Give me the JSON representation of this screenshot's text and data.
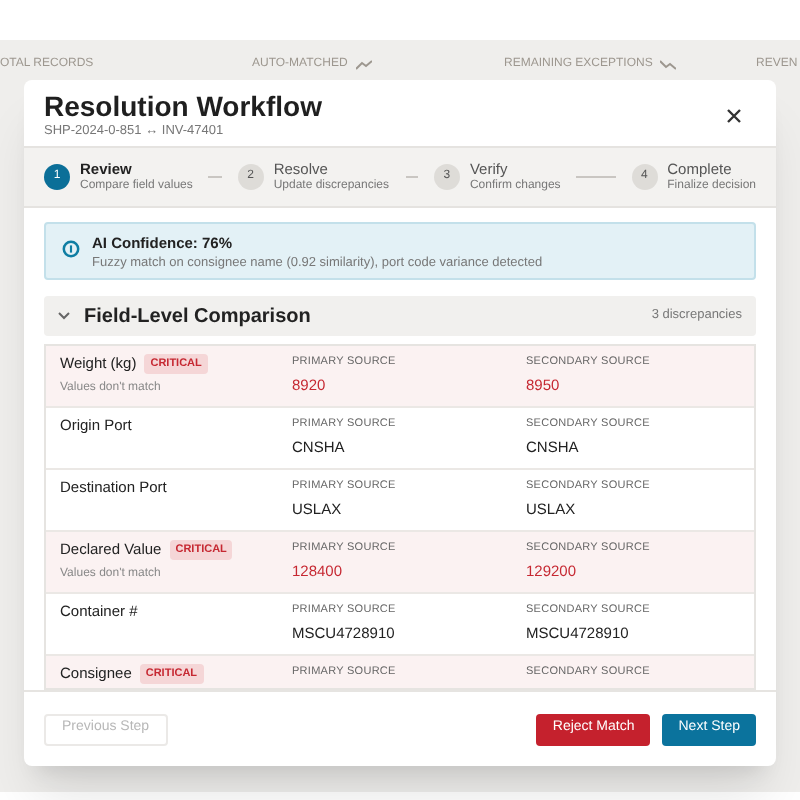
{
  "background_stats": [
    {
      "label": "OTAL RECORDS"
    },
    {
      "label": "AUTO-MATCHED",
      "trend_up": true
    },
    {
      "label": "REMAINING EXCEPTIONS",
      "trend_down": true
    },
    {
      "label": "REVEN"
    }
  ],
  "modal": {
    "title": "Resolution Workflow",
    "subtitle": "SHP-2024-0-851 ↔ INV-47401",
    "steps": [
      {
        "number": "1",
        "title": "Review",
        "subtitle": "Compare field values",
        "selected": true
      },
      {
        "number": "2",
        "title": "Resolve",
        "subtitle": "Update discrepancies",
        "selected": false
      },
      {
        "number": "3",
        "title": "Verify",
        "subtitle": "Confirm changes",
        "selected": false
      },
      {
        "number": "4",
        "title": "Complete",
        "subtitle": "Finalize decision",
        "selected": false
      }
    ],
    "alert": {
      "title": "AI Confidence: 76%",
      "text": "Fuzzy match on consignee name (0.92 similarity), port code variance detected"
    },
    "section": {
      "title": "Field-Level Comparison",
      "expanded": true,
      "count": "3 discrepancies"
    },
    "rows": [
      {
        "field": "Weight (kg)",
        "badge": "CRITICAL",
        "note": "Values don't match",
        "mismatch": true,
        "primary_label": "PRIMARY SOURCE",
        "primary": "8920",
        "secondary_label": "SECONDARY SOURCE",
        "secondary": "8950"
      },
      {
        "field": "Origin Port",
        "mismatch": false,
        "primary_label": "PRIMARY SOURCE",
        "primary": "CNSHA",
        "secondary_label": "SECONDARY SOURCE",
        "secondary": "CNSHA"
      },
      {
        "field": "Destination Port",
        "mismatch": false,
        "primary_label": "PRIMARY SOURCE",
        "primary": "USLAX",
        "secondary_label": "SECONDARY SOURCE",
        "secondary": "USLAX"
      },
      {
        "field": "Declared Value",
        "badge": "CRITICAL",
        "note": "Values don't match",
        "mismatch": true,
        "primary_label": "PRIMARY SOURCE",
        "primary": "128400",
        "secondary_label": "SECONDARY SOURCE",
        "secondary": "129200"
      },
      {
        "field": "Container #",
        "mismatch": false,
        "primary_label": "PRIMARY SOURCE",
        "primary": "MSCU4728910",
        "secondary_label": "SECONDARY SOURCE",
        "secondary": "MSCU4728910"
      },
      {
        "field": "Consignee",
        "badge": "CRITICAL",
        "mismatch": true,
        "primary_label": "PRIMARY SOURCE",
        "secondary_label": "SECONDARY SOURCE"
      }
    ],
    "buttons": [
      {
        "label": "Previous Step",
        "kind": "secondary",
        "disabled": true
      },
      {
        "label": "Reject Match",
        "kind": "danger",
        "disabled": false
      },
      {
        "label": "Next Step",
        "kind": "primary",
        "disabled": false
      }
    ]
  }
}
